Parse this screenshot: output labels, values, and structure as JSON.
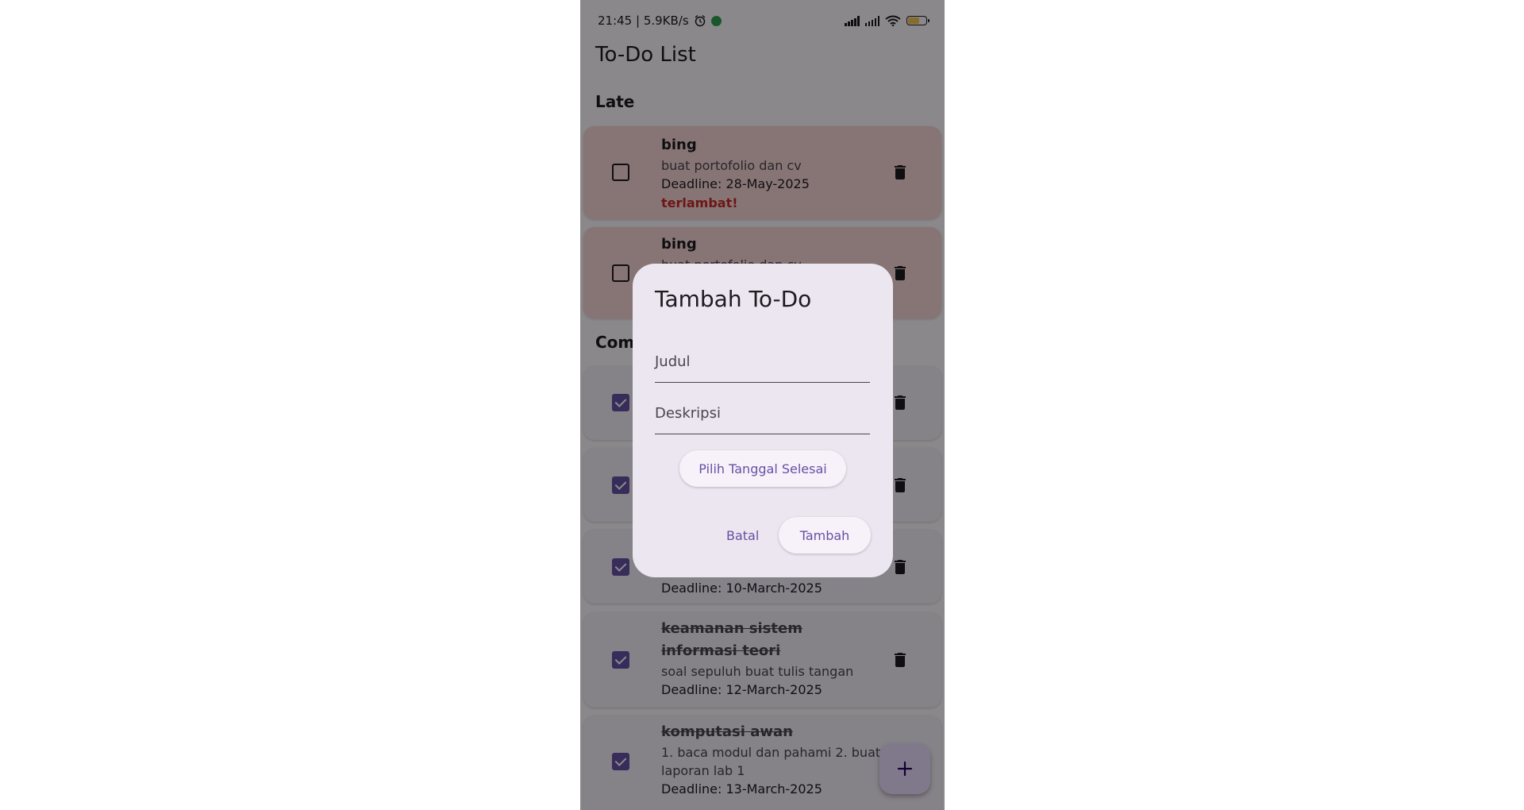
{
  "status_bar": {
    "time_speed": "21:45 | 5.9KB/s",
    "battery_level": "87"
  },
  "app": {
    "title": "To-Do List"
  },
  "sections": {
    "late": "Late",
    "completed": "Completed"
  },
  "late_todos": [
    {
      "title": "bing",
      "description": "buat portofolio dan cv",
      "deadline": "Deadline: 28-May-2025",
      "status": "terlambat!"
    },
    {
      "title": "bing",
      "description": "buat portofolio dan cv"
    }
  ],
  "completed_todos": [
    {
      "deadline": "Deadline: 10-March-2025"
    },
    {
      "title": "keamanan sistem informasi teori",
      "description": "soal sepuluh buat tulis tangan",
      "deadline": "Deadline: 12-March-2025"
    },
    {
      "title": "komputasi awan",
      "description": "1. baca modul dan pahami  2. buat laporan lab 1",
      "deadline": "Deadline: 13-March-2025"
    }
  ],
  "dialog": {
    "title": "Tambah To-Do",
    "title_field_placeholder": "Judul",
    "description_field_placeholder": "Deskripsi",
    "pick_date_label": "Pilih Tanggal Selesai",
    "cancel_label": "Batal",
    "add_label": "Tambah"
  },
  "icons": {
    "fab": "plus-icon",
    "delete": "trash-icon",
    "status_alarm": "alarm-icon"
  },
  "colors": {
    "accent": "#6750a4",
    "late_card": "#f6d6d6",
    "late_text": "#c62828"
  }
}
